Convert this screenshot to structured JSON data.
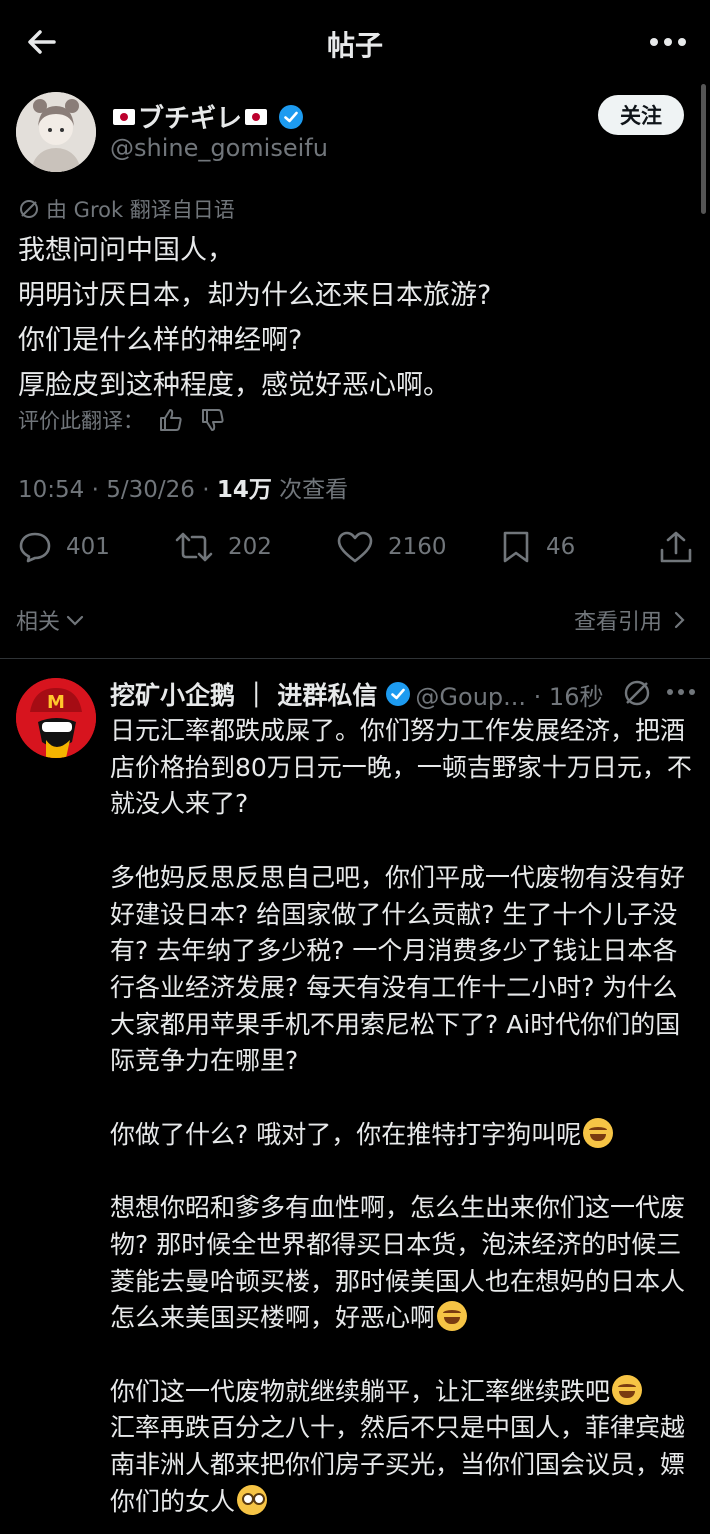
{
  "header": {
    "title": "帖子"
  },
  "post": {
    "display_name": "ブチギレ",
    "handle": "@shine_gomiseifu",
    "follow_label": "关注",
    "translated_note": "由 Grok 翻译自日语",
    "lines": [
      "我想问问中国人，",
      "明明讨厌日本，却为什么还来日本旅游?",
      "你们是什么样的神经啊?",
      "厚脸皮到这种程度，感觉好恶心啊。"
    ],
    "rate_label": "评价此翻译：",
    "time": "10:54 · 5/30/26 · ",
    "views_count": "14万",
    "views_label": " 次查看",
    "stats": {
      "replies": "401",
      "reposts": "202",
      "likes": "2160",
      "bookmarks": "46"
    }
  },
  "related_label": "相关",
  "quotes_label": "查看引用",
  "reply": {
    "name": "挖矿小企鹅 ｜ 进群私信",
    "handle": "@Goup... · 16秒",
    "paragraphs": [
      {
        "text": "日元汇率都跌成屎了。你们努力工作发展经济，把酒店价格抬到80万日元一晚，一顿吉野家十万日元，不就没人来了?"
      },
      {
        "text": "多他妈反思反思自己吧，你们平成一代废物有没有好好建设日本? 给国家做了什么贡献? 生了十个儿子没有? 去年纳了多少税? 一个月消费多少了钱让日本各行各业经济发展? 每天有没有工作十二小时? 为什么大家都用苹果手机不用索尼松下了? Ai时代你们的国际竞争力在哪里?"
      },
      {
        "text": "你做了什么? 哦对了，你在推特打字狗叫呢"
      },
      {
        "text": "想想你昭和爹多有血性啊，怎么生出来你们这一代废物? 那时候全世界都得买日本货，泡沫经济的时候三菱能去曼哈顿买楼，那时候美国人也在想妈的日本人怎么来美国买楼啊，好恶心啊"
      },
      {
        "text": "你们这一代废物就继续躺平，让汇率继续跌吧"
      },
      {
        "text": "汇率再跌百分之八十，然后不只是中国人，菲律宾越南非洲人都来把你们房子买光，当你们国会议员，嫖你们的女人"
      }
    ]
  },
  "colors": {
    "background": "#000000",
    "text": "#e7e9ea",
    "muted": "#71767b",
    "verified": "#1d9bf0"
  }
}
